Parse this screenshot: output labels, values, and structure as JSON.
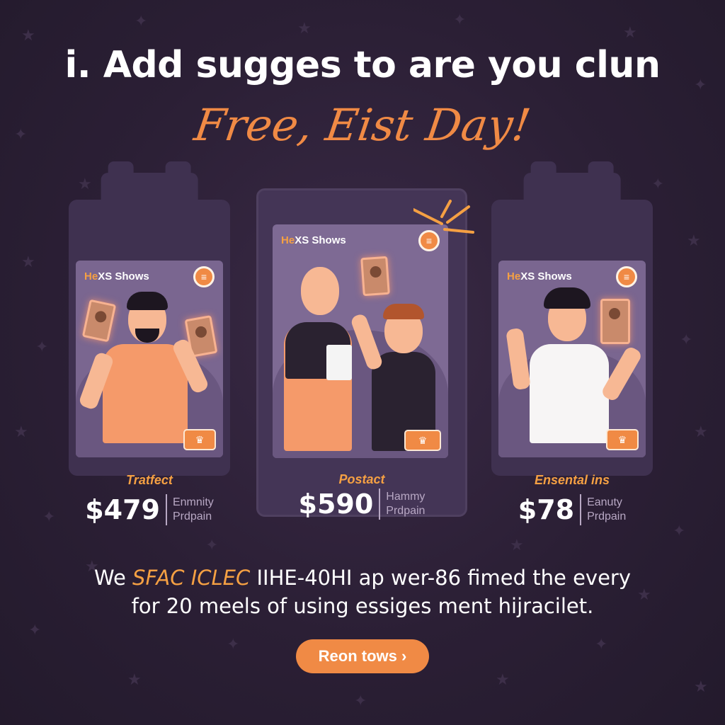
{
  "headline": "i. Add sugges to are you clun",
  "subhead": "Free, Eist Day!",
  "cards": [
    {
      "brand": "He",
      "title": "XS Shows",
      "label": "Tratfect",
      "price": "$479",
      "note_line1": "Enmnity",
      "note_line2": "Prdpain"
    },
    {
      "brand": "He",
      "title": "XS Shows",
      "label": "Postact",
      "price": "$590",
      "note_line1": "Hammy",
      "note_line2": "Prdpain"
    },
    {
      "brand": "He",
      "title": "XS Shows",
      "label": "Ensental ins",
      "price": "$78",
      "note_line1": "Eanuty",
      "note_line2": "Prdpain"
    }
  ],
  "body": {
    "line1_pre": "We ",
    "line1_highlight": "SFAC ICLEC",
    "line1_post": " IIHE-40HI ap wer-86 fimed the every",
    "line2": "for 20 meels of using essiges ment hijracilet."
  },
  "cta_label": "Reon tows ›",
  "icons": {
    "menu": "menu-icon",
    "crown": "crown-icon"
  },
  "colors": {
    "background": "#2a1e33",
    "accent": "#f08a45",
    "card": "#3f3150"
  }
}
